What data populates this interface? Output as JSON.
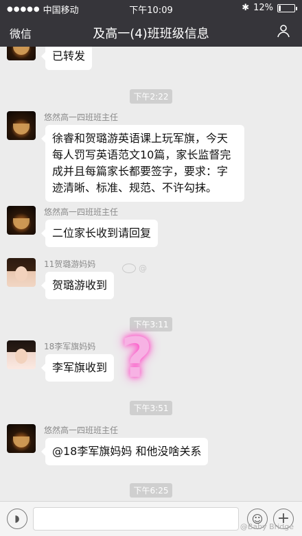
{
  "status_bar": {
    "carrier": "中国移动",
    "time": "下午10:09",
    "battery": "12%",
    "battery_level": 0.12
  },
  "nav": {
    "back_label": "微信",
    "title": "及高一(4)班班级信息"
  },
  "messages": [
    {
      "type": "partial",
      "text": "已转发"
    },
    {
      "type": "time",
      "text": "下午2:22"
    },
    {
      "type": "msg",
      "sender": "悠然高一四班班主任",
      "text": "徐睿和贺璐游英语课上玩军旗，今天每人罚写英语范文10篇，家长监督完成并且每篇家长都要签字，要求：字迹清晰、标准、规范、不许勾抹。"
    },
    {
      "type": "msg",
      "sender": "悠然高一四班班主任",
      "text": "二位家长收到请回复"
    },
    {
      "type": "msg",
      "sender": "11贺璐游妈妈",
      "text": "贺璐游收到"
    },
    {
      "type": "time",
      "text": "下午3:11"
    },
    {
      "type": "msg",
      "sender": "18李军旗妈妈",
      "text": "李军旗收到"
    },
    {
      "type": "time",
      "text": "下午3:51"
    },
    {
      "type": "msg",
      "sender": "悠然高一四班班主任",
      "text": "@18李军旗妈妈 和他没啥关系"
    },
    {
      "type": "time",
      "text": "下午6:25"
    }
  ],
  "watermarks": {
    "mid": "@",
    "bottom": "@Baby Bridge"
  },
  "overlay_mark": "?",
  "icons": {
    "voice": "voice-icon",
    "emoji": "emoji-icon",
    "plus": "plus-icon",
    "more": "more-icon"
  }
}
